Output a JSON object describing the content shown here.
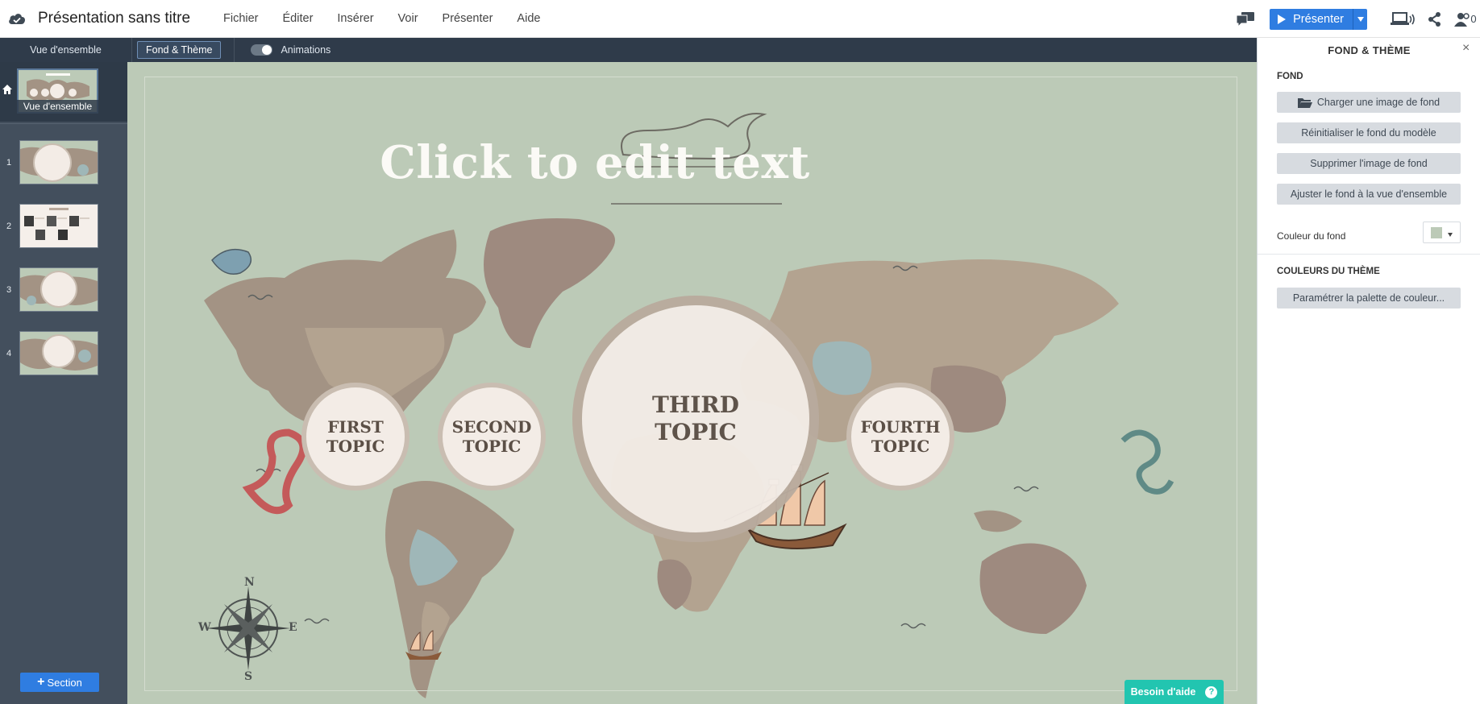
{
  "app": {
    "doc_title": "Présentation sans titre",
    "menu": [
      "Fichier",
      "Éditer",
      "Insérer",
      "Voir",
      "Présenter",
      "Aide"
    ],
    "present_label": "Présenter",
    "users_count": "0",
    "accent_color": "#2f7de1"
  },
  "toolbar": {
    "overview_label": "Vue d'ensemble",
    "theme_label": "Fond & Thème",
    "animations_label": "Animations"
  },
  "sidebar": {
    "overview_label": "Vue d'ensemble",
    "slides": [
      "1",
      "2",
      "3",
      "4"
    ],
    "section_label": "Section"
  },
  "canvas": {
    "title": "Click to edit text",
    "topics": [
      {
        "line1": "FIRST",
        "line2": "TOPIC"
      },
      {
        "line1": "SECOND",
        "line2": "TOPIC"
      },
      {
        "line1": "THIRD",
        "line2": "TOPIC"
      },
      {
        "line1": "FOURTH",
        "line2": "TOPIC"
      }
    ],
    "compass": {
      "n": "N",
      "s": "S",
      "e": "E",
      "w": "W"
    },
    "background_color": "#bccab7",
    "help_label": "Besoin d'aide",
    "help_icon": "?"
  },
  "panel": {
    "title": "FOND & THÈME",
    "close": "×",
    "section_background": "FOND",
    "btn_upload": "Charger une image de fond",
    "btn_reset": "Réinitialiser le fond du modèle",
    "btn_delete": "Supprimer l'image de fond",
    "btn_fit": "Ajuster le fond à la vue d'ensemble",
    "color_label": "Couleur du fond",
    "swatch_color": "#bccab7",
    "section_theme": "COULEURS DU THÈME",
    "btn_palette": "Paramétrer la palette de couleur..."
  }
}
